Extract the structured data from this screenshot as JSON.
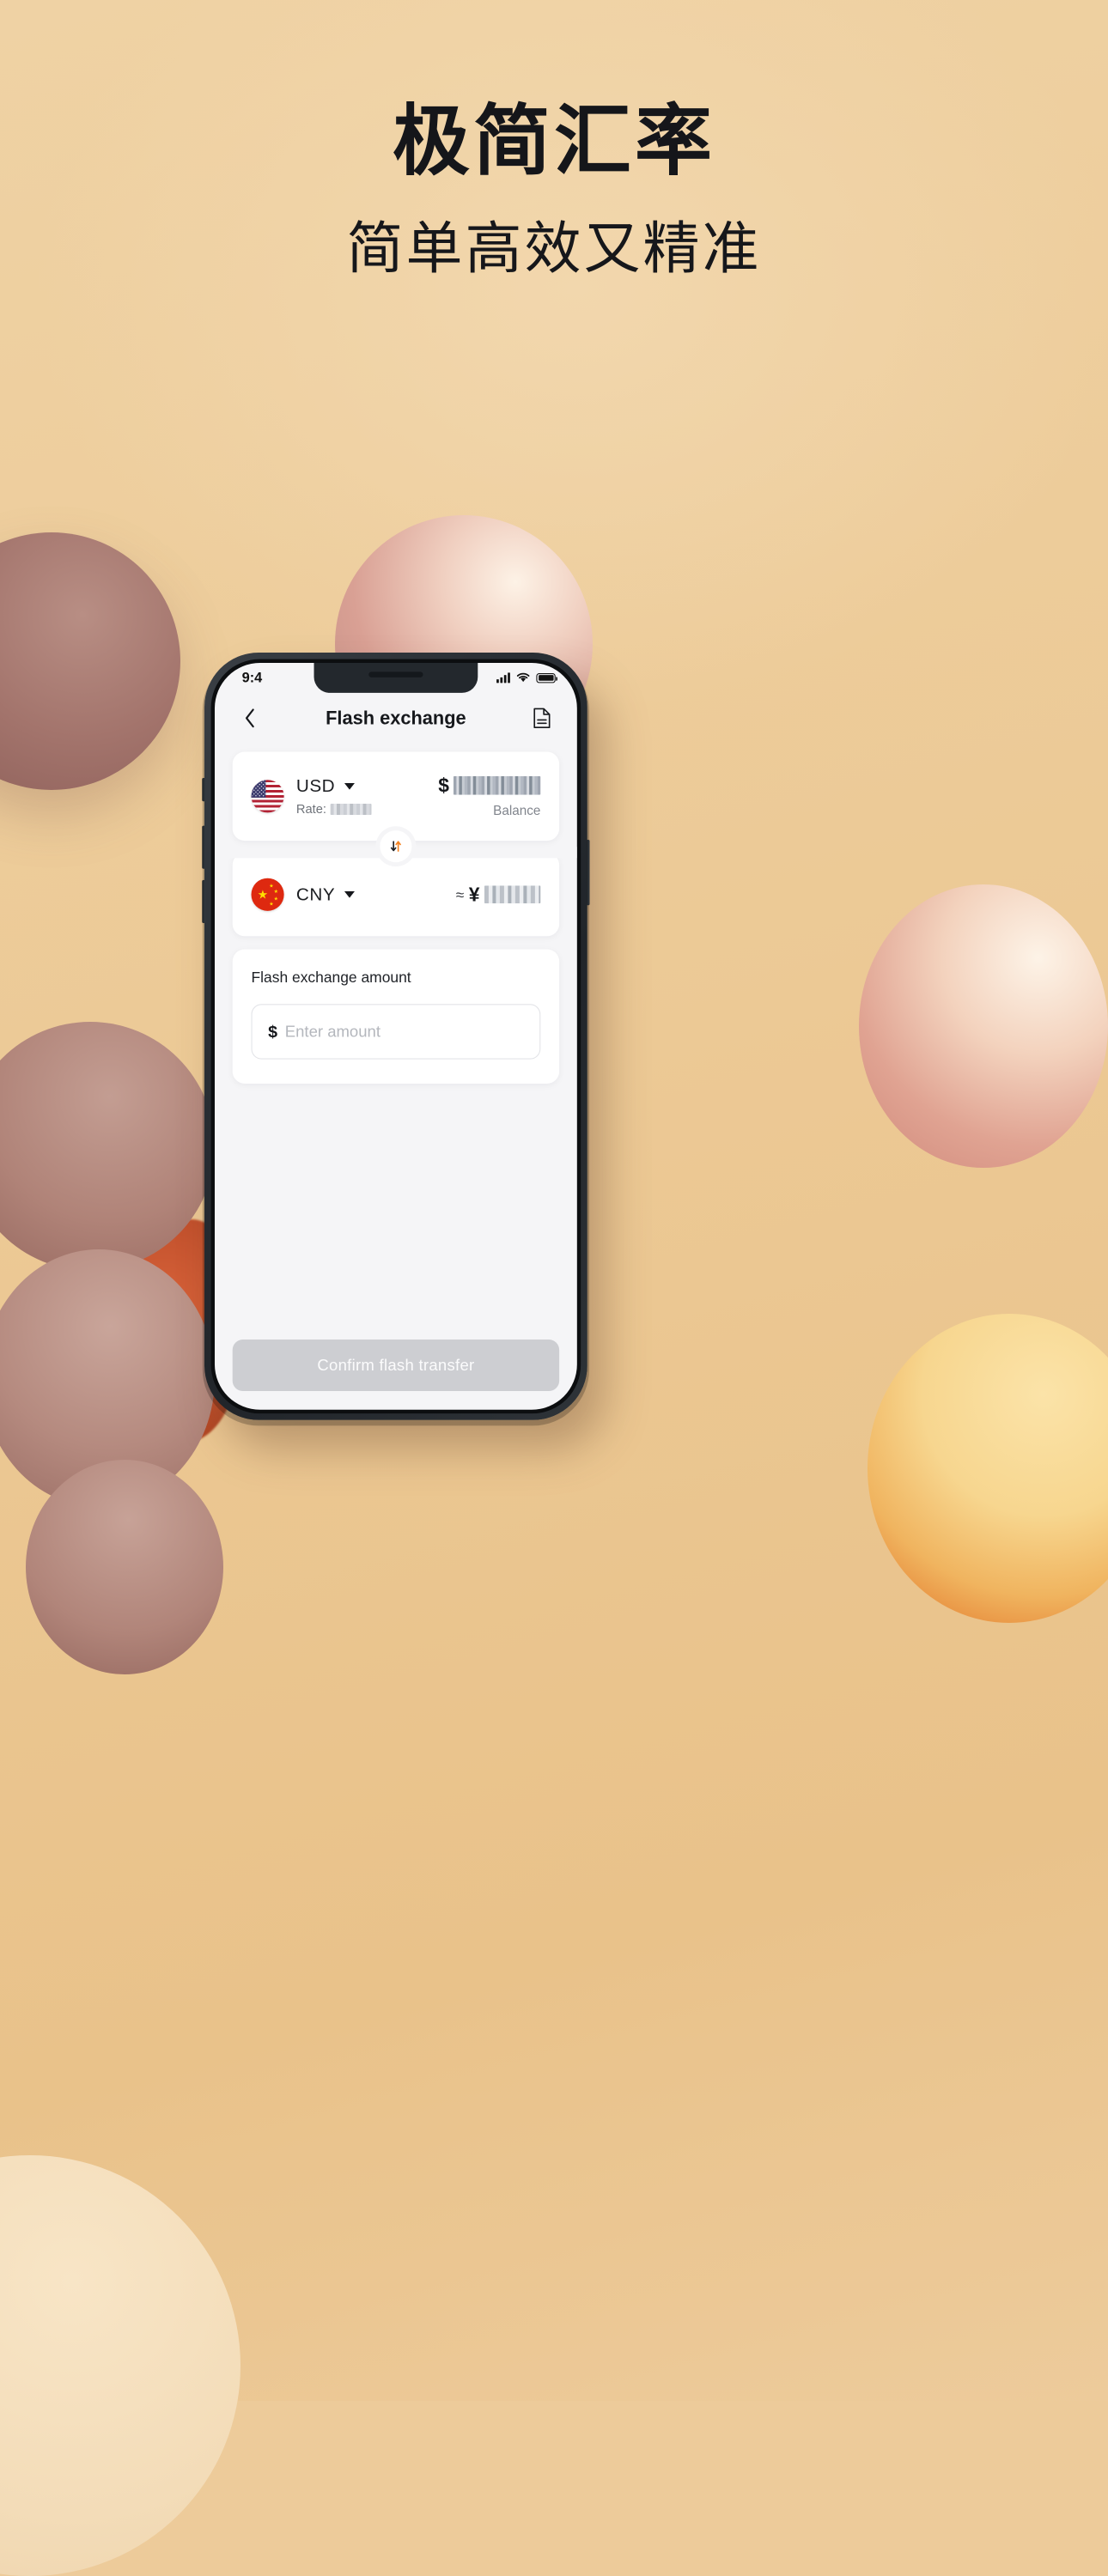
{
  "hero": {
    "title": "极简汇率",
    "subtitle": "简单高效又精准"
  },
  "colors": {
    "page_background": "#edcb9a",
    "accent_orange": "#f58220",
    "phone_frame": "#2b3036",
    "screen_background": "#f5f5f7",
    "card_background": "#ffffff",
    "title_text": "#16181c",
    "muted_text": "#81858d",
    "button_disabled": "#cdced2",
    "flag_usd_red": "#b22234",
    "flag_usd_blue": "#3c3b6e",
    "flag_cny_red": "#de2910",
    "flag_cny_yellow": "#ffde00"
  },
  "phone": {
    "status_bar": {
      "time": "9:4",
      "icons": [
        "cellular-signal-icon",
        "wifi-icon",
        "battery-icon"
      ]
    },
    "nav": {
      "back_icon": "chevron-left-icon",
      "title": "Flash exchange",
      "action_icon": "document-icon"
    },
    "from_card": {
      "flag_icon": "flag-usd-icon",
      "currency_code": "USD",
      "dropdown_icon": "caret-down-icon",
      "rate_label": "Rate:",
      "rate_value": "",
      "amount_currency_symbol": "$",
      "amount_value": "",
      "balance_label": "Balance"
    },
    "swap": {
      "icon": "swap-vertical-arrows-icon",
      "down_arrow_color": "#1d2024",
      "up_arrow_color": "#f58220"
    },
    "to_card": {
      "flag_icon": "flag-cny-icon",
      "currency_code": "CNY",
      "dropdown_icon": "caret-down-icon",
      "approx_symbol": "≈",
      "amount_currency_symbol": "¥",
      "amount_value": ""
    },
    "amount_card": {
      "label": "Flash exchange amount",
      "input_currency_symbol": "$",
      "input_value": "",
      "input_placeholder": "Enter amount"
    },
    "confirm_button": {
      "label": "Confirm flash transfer",
      "enabled": false
    }
  },
  "decorations": [
    {
      "name": "blob-mauve-1",
      "color": "#a3746c"
    },
    {
      "name": "blob-mauve-2",
      "color": "#b08378"
    },
    {
      "name": "blob-mauve-3",
      "color": "#b58a7f"
    },
    {
      "name": "blob-mauve-4",
      "color": "#b1857a"
    },
    {
      "name": "blob-red-accent",
      "color": "#c1502c"
    },
    {
      "name": "blob-pink-top",
      "color": "#d9a094"
    },
    {
      "name": "blob-peach-right",
      "color": "#e0a392"
    },
    {
      "name": "blob-orange-right",
      "color": "#f0b45f"
    },
    {
      "name": "blob-cream-bottom",
      "color": "#f3dcb8"
    }
  ]
}
